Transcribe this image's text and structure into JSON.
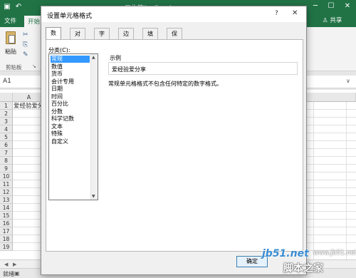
{
  "window": {
    "title": "工作簿1 - Excel",
    "controls": [
      "─",
      "☐",
      "✕"
    ]
  },
  "ribbon": {
    "tabs": [
      {
        "label": "文件",
        "active": false
      },
      {
        "label": "开始",
        "active": true
      }
    ],
    "share_label": "共享",
    "clipboard": {
      "paste_label": "粘贴",
      "group_label": "剪贴板"
    }
  },
  "formula_bar": {
    "cell_ref": "A1",
    "right_marker": "∨"
  },
  "sheet": {
    "columns": [
      "A"
    ],
    "rows": [
      "1",
      "2",
      "3",
      "4",
      "5",
      "6",
      "7",
      "8",
      "9",
      "10",
      "11",
      "12",
      "13",
      "14",
      "15",
      "16",
      "17",
      "18",
      "19"
    ],
    "cell_a1": "爱经验爱分享"
  },
  "status": {
    "ready_text": "就绪"
  },
  "dialog": {
    "title": "设置单元格格式",
    "help": "?",
    "close": "✕",
    "tabs": [
      {
        "label": "数字",
        "active": true
      },
      {
        "label": "对齐",
        "active": false
      },
      {
        "label": "字体",
        "active": false
      },
      {
        "label": "边框",
        "active": false
      },
      {
        "label": "填充",
        "active": false
      },
      {
        "label": "保护",
        "active": false
      }
    ],
    "category_label": "分类(C):",
    "categories": [
      {
        "label": "常规",
        "selected": true
      },
      {
        "label": "数值",
        "selected": false
      },
      {
        "label": "货币",
        "selected": false
      },
      {
        "label": "会计专用",
        "selected": false
      },
      {
        "label": "日期",
        "selected": false
      },
      {
        "label": "时间",
        "selected": false
      },
      {
        "label": "百分比",
        "selected": false
      },
      {
        "label": "分数",
        "selected": false
      },
      {
        "label": "科学记数",
        "selected": false
      },
      {
        "label": "文本",
        "selected": false
      },
      {
        "label": "特殊",
        "selected": false
      },
      {
        "label": "自定义",
        "selected": false
      }
    ],
    "sample_label": "示例",
    "sample_value": "爱经验爱分享",
    "description": "常规单元格格式不包含任何特定的数字格式。",
    "ok_label": "确定"
  },
  "watermark": {
    "site": "jb51.net",
    "name": "脚本之家",
    "url": "www.jb51.net"
  },
  "colors": {
    "excel_green": "#217346",
    "selection_blue": "#3399ff"
  }
}
